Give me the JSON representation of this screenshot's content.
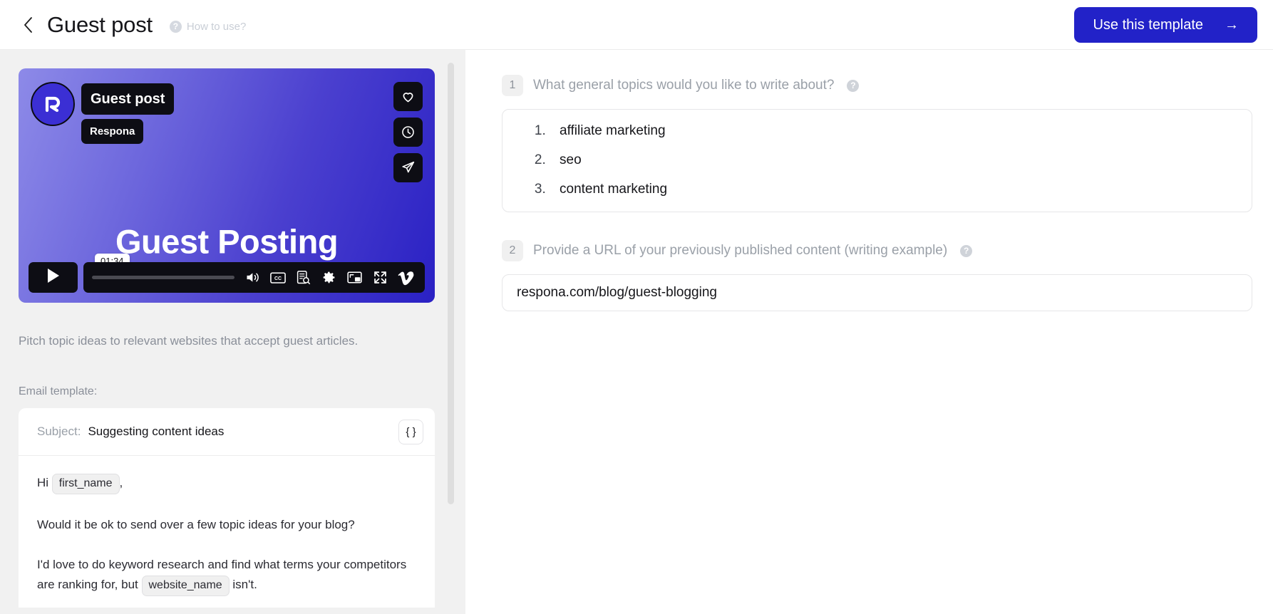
{
  "header": {
    "back_icon": "chevron-left-icon",
    "title": "Guest post",
    "help_icon": "question-circle-icon",
    "help_label": "How to use?",
    "cta_label": "Use this template",
    "cta_arrow": "→",
    "cta_color": "#2222c8"
  },
  "video": {
    "logo_letter": "R",
    "badge_title": "Guest post",
    "badge_sub": "Respona",
    "heading": "Guest Posting",
    "time_tooltip": "01:34",
    "actions": [
      "heart-icon",
      "clock-icon",
      "share-plane-icon"
    ],
    "controls": {
      "play": "play-icon",
      "volume": "volume-icon",
      "captions": "cc-icon",
      "transcript": "transcript-search-icon",
      "settings": "gear-icon",
      "pip": "picture-in-picture-icon",
      "fullscreen": "fullscreen-icon",
      "vimeo": "vimeo-logo-icon"
    },
    "gradient_from": "#8d8ae8",
    "gradient_to": "#2a21c4"
  },
  "sidebar": {
    "description": "Pitch topic ideas to relevant websites that accept guest articles.",
    "email_template_label": "Email template:",
    "email": {
      "subject_label": "Subject:",
      "subject_value": "Suggesting content ideas",
      "braces_label": "{ }",
      "greeting_prefix": "Hi",
      "greeting_token": "first_name",
      "greeting_suffix": ",",
      "paragraph_2": "Would it be ok to send over a few topic ideas for your blog?",
      "paragraph_3_a": "I'd love to do keyword research and find what terms your competitors are ranking for, but",
      "paragraph_3_token": "website_name",
      "paragraph_3_b": "isn't."
    }
  },
  "questions": [
    {
      "number": "1",
      "text": "What general topics would you like to write about?",
      "help_icon": "question-circle-icon",
      "type": "ordered-list",
      "items": [
        "affiliate marketing",
        "seo",
        "content marketing"
      ]
    },
    {
      "number": "2",
      "text": "Provide a URL of your previously published content (writing example)",
      "help_icon": "question-circle-icon",
      "type": "text-input",
      "value": "respona.com/blog/guest-blogging",
      "placeholder": ""
    }
  ]
}
